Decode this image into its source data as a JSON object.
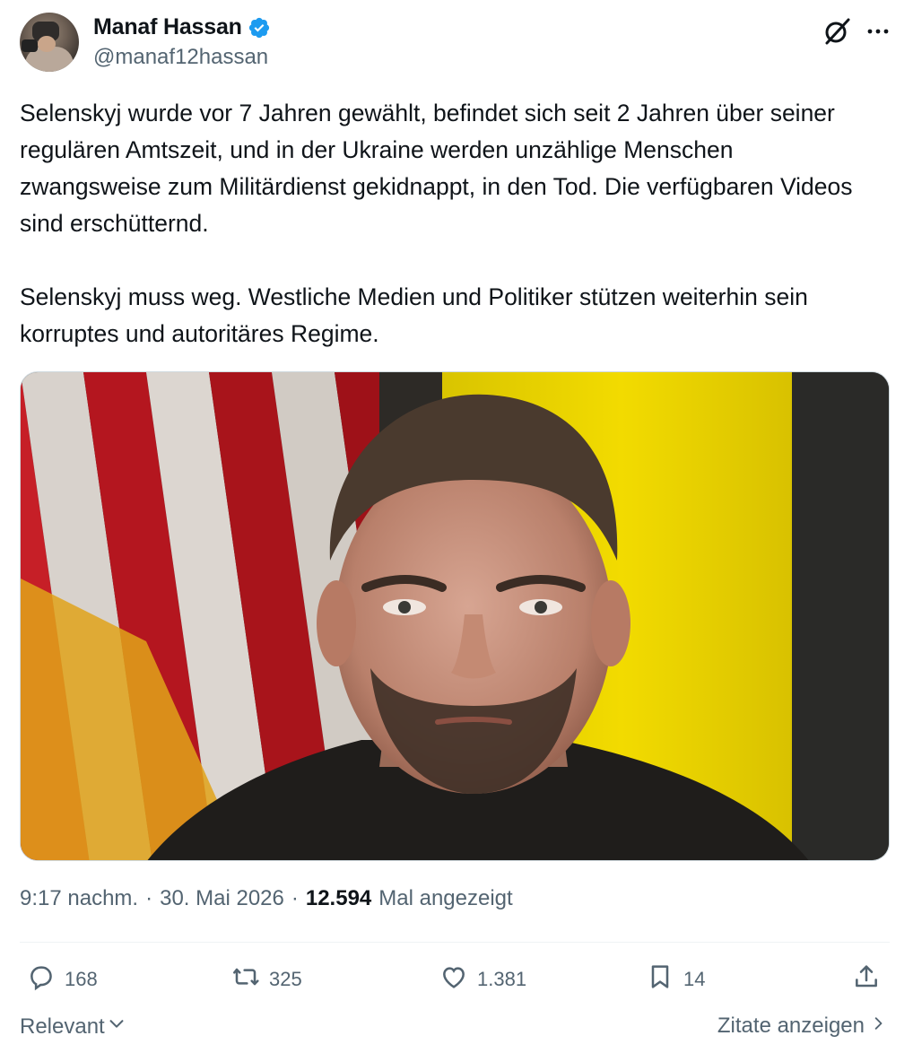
{
  "author": {
    "display_name": "Manaf Hassan",
    "handle": "@manaf12hassan",
    "verified": true,
    "verified_color": "#1d9bf0"
  },
  "tweet": {
    "paragraphs": [
      "Selenskyj wurde vor 7 Jahren gewählt, befindet sich seit 2 Jahren über seiner regulären Amtszeit, und in der Ukraine werden unzählige Menschen zwangsweise zum Militärdienst gekidnappt, in den Tod. Die verfügbaren Videos sind erschütternd.",
      "Selenskyj muss weg. Westliche Medien und Politiker stützen weiterhin sein korruptes und autoritäres Regime."
    ]
  },
  "meta": {
    "time": "9:17 nachm.",
    "separator": "·",
    "date": "30. Mai 2026",
    "views_count": "12.594",
    "views_label": "Mal angezeigt"
  },
  "actions": {
    "replies": "168",
    "reposts": "325",
    "likes": "1.381",
    "bookmarks": "14"
  },
  "footer": {
    "sort_label": "Relevant",
    "quotes_label": "Zitate anzeigen"
  },
  "icons": {
    "verified": "verified-badge-icon",
    "grok": "grok-icon",
    "more": "more-icon",
    "reply": "reply-icon",
    "repost": "repost-icon",
    "like": "heart-icon",
    "bookmark": "bookmark-icon",
    "share": "share-icon"
  },
  "colors": {
    "text_primary": "#0f1419",
    "text_secondary": "#536471",
    "accent": "#1d9bf0"
  }
}
